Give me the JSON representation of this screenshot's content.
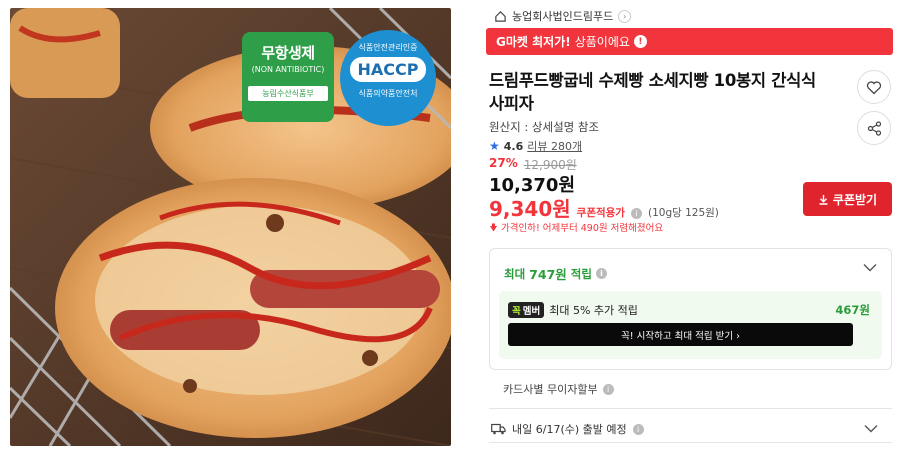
{
  "image": {
    "alt": "pizza bread product photo",
    "badge_antibiotic": {
      "title": "무항생제",
      "subtitle": "(NON ANTIBIOTIC)",
      "footer": "농림수산식품부"
    },
    "badge_haccp": {
      "top": "식품안전관리인증",
      "main": "HACCP",
      "bottom": "식품의약품안전처"
    }
  },
  "seller": {
    "name": "농업회사법인드림푸드",
    "chevron": "›"
  },
  "promo": {
    "strong": "G마켓 최저가!",
    "text": "상품이에요",
    "info": "!"
  },
  "product": {
    "title": "드림푸드빵굽네 수제빵 소세지빵 10봉지 간식식사피자",
    "origin": "원산지 : 상세설명 참조",
    "rating": "4.6",
    "review": "리뷰 280개"
  },
  "price": {
    "discount_pct": "27%",
    "original": "12,900원",
    "sale": "10,370원",
    "coupon_price": "9,340원",
    "coupon_label": "쿠폰적용가",
    "unit": "(10g당 125원)",
    "drop_notice": "가격인하! 어제부터 490원 저렴해졌어요"
  },
  "coupon_button": {
    "label": "쿠폰받기"
  },
  "points": {
    "prefix": "최대",
    "amount": "747원",
    "suffix": "적립",
    "member_badge_g": "꼭",
    "member_badge": "멤버",
    "member_text": "최대 5% 추가 적립",
    "member_amount": "467원",
    "member_cta": "꼭! 시작하고 최대 적립 받기 ›"
  },
  "installment": {
    "label": "카드사별 무이자할부"
  },
  "shipping": {
    "label": "내일 6/17(수) 출발 예정"
  },
  "colors": {
    "accent_red": "#f2353c",
    "green": "#2a9d3a",
    "star_blue": "#2f6fe6"
  },
  "icons": [
    "home-icon",
    "chevron-right-icon",
    "info-icon",
    "heart-icon",
    "share-icon",
    "star-icon",
    "download-icon",
    "chevron-down-icon",
    "truck-icon"
  ]
}
